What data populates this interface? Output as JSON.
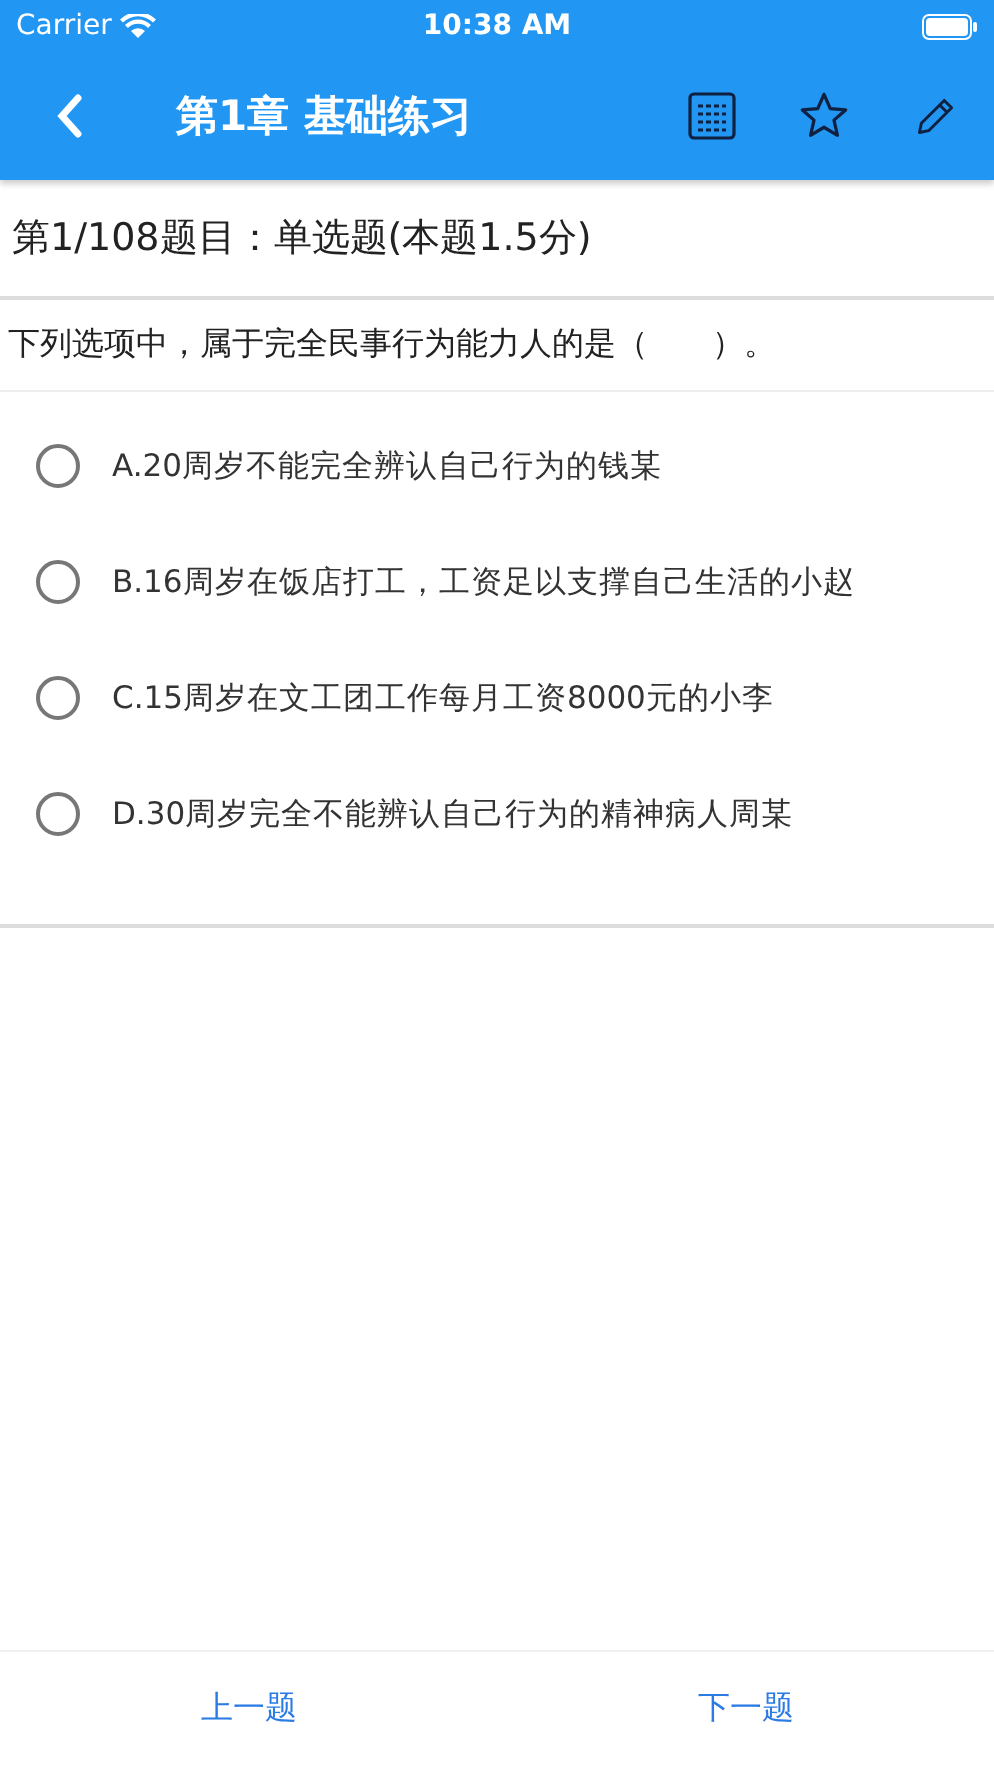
{
  "status_bar": {
    "carrier": "Carrier",
    "time": "10:38 AM"
  },
  "nav": {
    "title": "第1章 基础练习"
  },
  "question": {
    "header": "第1/108题目：单选题(本题1.5分)",
    "stem": "下列选项中，属于完全民事行为能力人的是（　　）。",
    "options": [
      {
        "label": "A.20周岁不能完全辨认自己行为的钱某",
        "selected": false
      },
      {
        "label": "B.16周岁在饭店打工，工资足以支撑自己生活的小赵",
        "selected": false
      },
      {
        "label": "C.15周岁在文工团工作每月工资8000元的小李",
        "selected": false
      },
      {
        "label": "D.30周岁完全不能辨认自己行为的精神病人周某",
        "selected": false
      }
    ]
  },
  "footer": {
    "prev": "上一题",
    "next": "下一题"
  }
}
